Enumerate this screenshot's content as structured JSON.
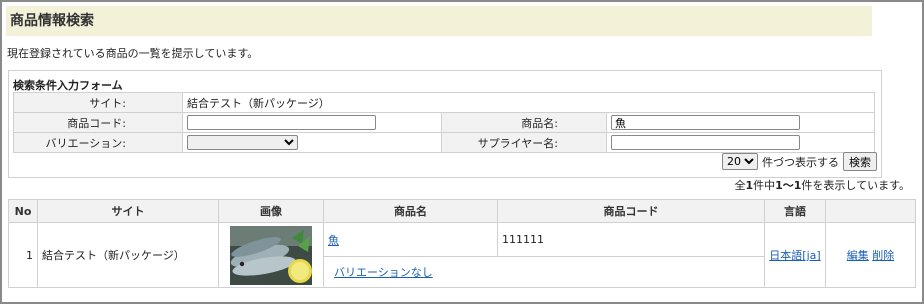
{
  "page": {
    "title": "商品情報検索",
    "description": "現在登録されている商品の一覧を提示しています。"
  },
  "form": {
    "title": "検索条件入力フォーム",
    "site_label": "サイト:",
    "site_value": "結合テスト（新パッケージ）",
    "code_label": "商品コード:",
    "code_value": "",
    "name_label": "商品名:",
    "name_value": "魚",
    "variation_label": "バリエーション:",
    "variation_value": "",
    "supplier_label": "サプライヤー名:",
    "supplier_value": "",
    "per_page_value": "20",
    "per_page_suffix": "件づつ表示する",
    "search_button": "検索"
  },
  "results": {
    "count_total": "1",
    "count_text_1": "全",
    "count_text_2": "件中",
    "count_range": "1～1",
    "count_text_3": "件を表示しています。",
    "columns": [
      "No",
      "サイト",
      "画像",
      "商品名",
      "商品コード",
      "言語",
      ""
    ],
    "rows": [
      {
        "no": "1",
        "site": "結合テスト（新パッケージ）",
        "image_alt": "fish-image",
        "name": "魚",
        "code": "111111",
        "variation": "バリエーションなし",
        "language": "日本語[ja]",
        "edit": "編集",
        "delete": "削除"
      }
    ]
  },
  "colors": {
    "title_bg": "#f3f1d8",
    "link": "#1a5fb4",
    "header_bg": "#f2f2f2"
  }
}
